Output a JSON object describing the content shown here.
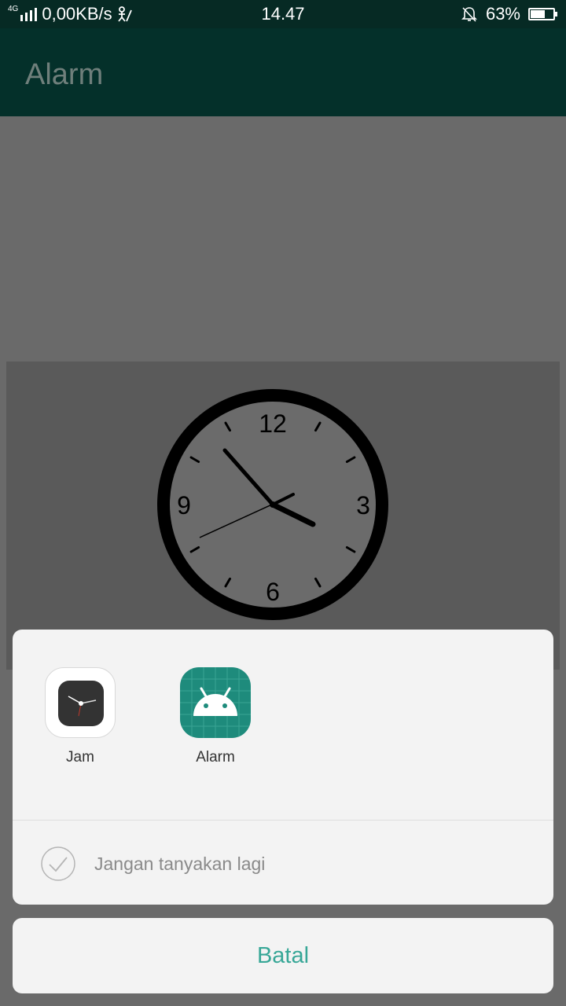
{
  "status_bar": {
    "network_type": "4G",
    "data_rate": "0,00KB/s",
    "time": "14.47",
    "battery_percent": "63%",
    "battery_level": 0.63
  },
  "app_bar": {
    "title": "Alarm"
  },
  "clock_face": {
    "numerals": [
      "12",
      "3",
      "6",
      "9"
    ]
  },
  "chooser": {
    "apps": [
      {
        "label": "Jam",
        "icon": "clock-app-icon"
      },
      {
        "label": "Alarm",
        "icon": "android-app-icon"
      }
    ],
    "dont_ask_label": "Jangan tanyakan lagi"
  },
  "cancel_label": "Batal",
  "colors": {
    "accent": "#37a797",
    "app_bar": "#04302a",
    "status_bar": "#062a24",
    "android_icon_bg": "#1e8b7c"
  }
}
